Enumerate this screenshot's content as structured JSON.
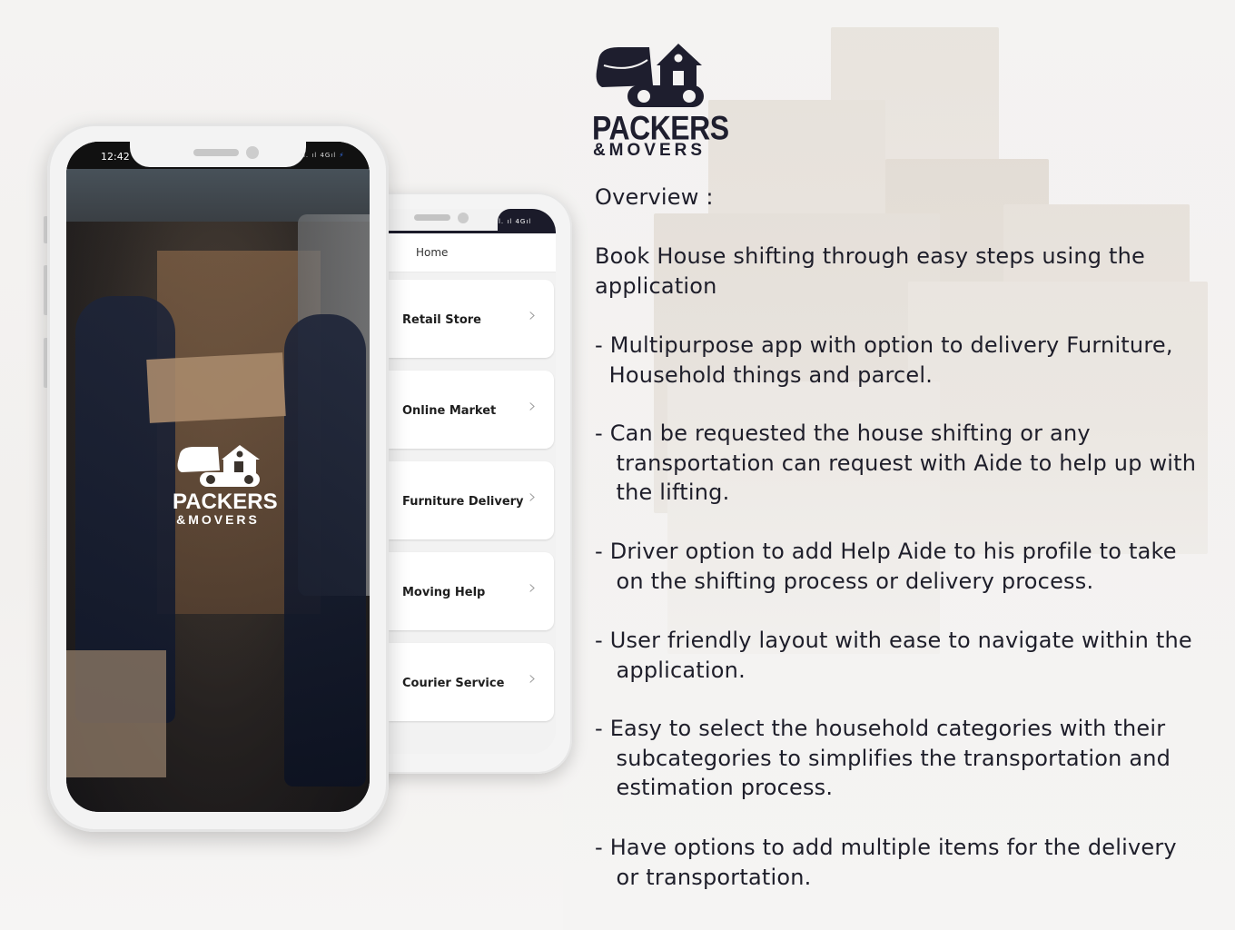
{
  "brand": {
    "logo_line1": "PACKERS",
    "logo_line2": "&MOVERS",
    "logo_icon": "truck-house-icon"
  },
  "splash_phone": {
    "status_time": "12:42",
    "status_icons": "ıl. ıl 4Gıl",
    "logo_line1": "PACKERS",
    "logo_line2": "&MOVERS"
  },
  "home_phone": {
    "status_icons": "ıl. ıl 4Gıl",
    "header_title": "Home",
    "categories": [
      {
        "label": "Retail Store",
        "icon": "chevron-right-icon"
      },
      {
        "label": "Online Market",
        "icon": "chevron-right-icon"
      },
      {
        "label": "Furniture Delivery",
        "icon": "chevron-right-icon"
      },
      {
        "label": "Moving Help",
        "icon": "chevron-right-icon"
      },
      {
        "label": "Courier Service",
        "icon": "chevron-right-icon"
      }
    ]
  },
  "overview": {
    "heading": "Overview :",
    "intro": "Book House shifting through easy steps using the\napplication",
    "points": [
      "- Multipurpose app with option to delivery Furniture,\n  Household things and parcel.",
      "- Can be requested the house shifting or any\n   transportation can request with Aide to help up with\n   the lifting.",
      "- Driver option to add Help Aide to his profile to take\n   on the shifting process or delivery process.",
      "- User friendly layout with ease to navigate within the\n   application.",
      "- Easy to select the household categories with their\n   subcategories to simplifies the transportation and\n   estimation process.",
      "- Have options to add multiple items for the delivery\n   or transportation."
    ]
  },
  "colors": {
    "text_dark": "#1e1e2a",
    "status_bolt": "#3a7bff",
    "phone_frame": "#f3f3f3",
    "card_bg": "#ffffff"
  }
}
